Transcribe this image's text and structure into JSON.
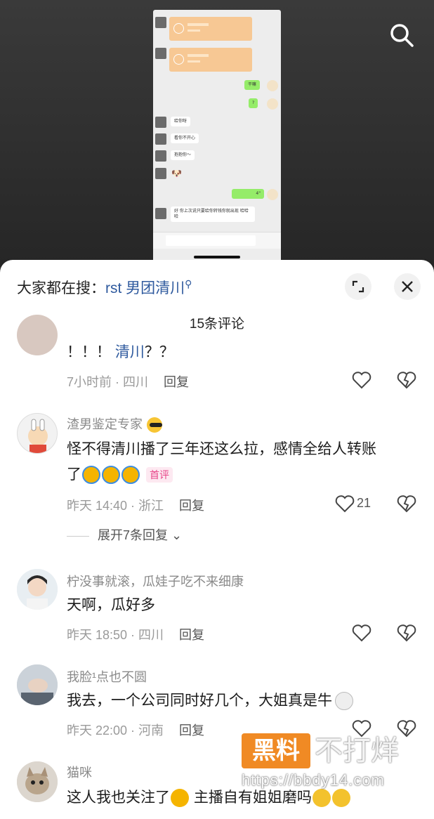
{
  "video": {
    "phone_chat": {
      "sent_1": "干嘛",
      "sent_2": "?",
      "recv_1": "给你呀",
      "recv_2": "看你不开心",
      "recv_3": "抱抱你～",
      "voice": "4\"",
      "recv_long": "好 你上次说只要给你转钱你就出现 哈哈哈"
    }
  },
  "sheet": {
    "hot_search_prefix": "大家都在搜：",
    "hot_search_topic": "rst 男团清川",
    "title": "15条评论"
  },
  "comments": [
    {
      "text_prefix": "！！！ ",
      "text_link": "清川",
      "text_suffix": "？？",
      "meta": "7小时前 · 四川",
      "reply": "回复"
    },
    {
      "name": "渣男鉴定专家",
      "text_line1": "怪不得清川播了三年还这么拉，感情全给人转账",
      "text_line2": "了",
      "badge": "首评",
      "meta": "昨天 14:40 · 浙江",
      "reply": "回复",
      "likes": "21",
      "more": "展开7条回复"
    },
    {
      "name": "柠没事就滚，瓜娃子吃不来细康",
      "text": "天啊，瓜好多",
      "meta": "昨天 18:50 · 四川",
      "reply": "回复"
    },
    {
      "name": "我脸¹点也不圆",
      "text": "我去，一个公司同时好几个，大姐真是牛",
      "meta": "昨天 22:00 · 河南",
      "reply": "回复"
    },
    {
      "name": "猫咪",
      "text_a": "这人我也关注了",
      "text_b": " 主播自有姐姐磨吗"
    }
  ],
  "watermark": {
    "box": "黑料",
    "tail": "不打烊",
    "url": "https://bbdy14.com"
  },
  "colors": {
    "topic_link": "#2f5a9e",
    "badge": "#e8488a",
    "watermark_orange": "#f08a24"
  }
}
